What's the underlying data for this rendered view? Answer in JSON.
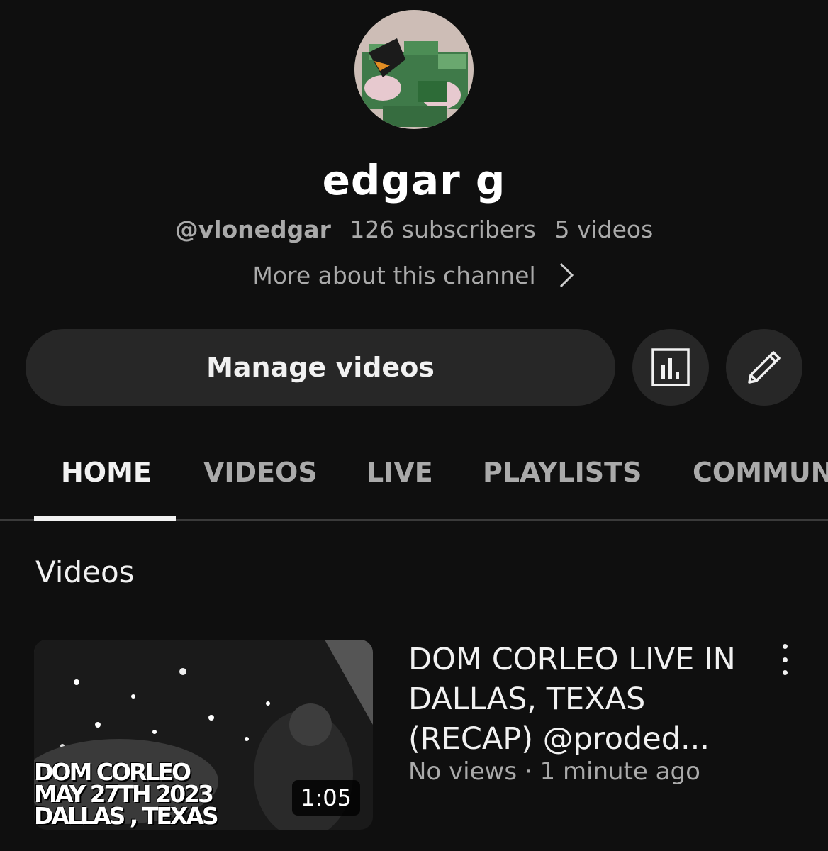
{
  "channel": {
    "name": "edgar g",
    "handle": "@vlonedgar",
    "subscribers": "126 subscribers",
    "video_count": "5 videos",
    "more_about": "More about this channel"
  },
  "actions": {
    "manage_label": "Manage videos",
    "analytics_icon": "analytics-icon",
    "edit_icon": "pencil-icon"
  },
  "tabs": [
    {
      "label": "HOME",
      "active": true
    },
    {
      "label": "VIDEOS",
      "active": false
    },
    {
      "label": "LIVE",
      "active": false
    },
    {
      "label": "PLAYLISTS",
      "active": false
    },
    {
      "label": "COMMUN",
      "active": false
    }
  ],
  "section": {
    "title": "Videos"
  },
  "videos": [
    {
      "title": "DOM CORLEO LIVE IN DALLAS, TEXAS (RECAP) @proded...",
      "views": "No views",
      "age": "1 minute ago",
      "meta_separator": "·",
      "duration": "1:05",
      "thumb_lines": [
        "DOM CORLEO",
        "MAY 27TH 2023",
        "DALLAS , TEXAS"
      ]
    }
  ]
}
